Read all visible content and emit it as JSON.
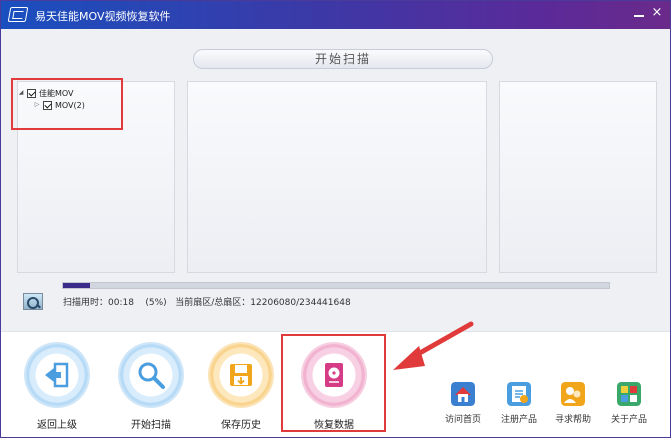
{
  "window": {
    "title": "易天佳能MOV视频恢复软件",
    "close_glyph": "×"
  },
  "scan_header": {
    "label": "开始扫描"
  },
  "tree": [
    {
      "label": "佳能MOV",
      "checked": true,
      "expanded": true
    },
    {
      "label": "MOV(2)",
      "checked": true,
      "expanded": false
    }
  ],
  "tree_glyphs": {
    "expanded": "◢",
    "collapsed": "▷"
  },
  "progress": {
    "percent_fraction": 0.05
  },
  "status": {
    "text": "扫描用时：00:18    (5%)   当前扇区/总扇区：12206080/234441648"
  },
  "footer": {
    "main_buttons": [
      {
        "label": "返回上级",
        "icon": "back-door-icon",
        "color": "#4a9ee0"
      },
      {
        "label": "开始扫描",
        "icon": "magnifier-icon",
        "color": "#4a9ee0"
      },
      {
        "label": "保存历史",
        "icon": "save-disk-icon",
        "color": "#f0a51a"
      },
      {
        "label": "恢复数据",
        "icon": "hard-drive-icon",
        "color": "#d63b86"
      }
    ],
    "small_buttons": [
      {
        "label": "访问首页",
        "icon": "home-icon"
      },
      {
        "label": "注册产品",
        "icon": "register-icon"
      },
      {
        "label": "寻求帮助",
        "icon": "help-icon"
      },
      {
        "label": "关于产品",
        "icon": "about-icon"
      }
    ]
  },
  "colors": {
    "accent_red": "#e03a3a",
    "progress_fill": "#3a2a8a"
  }
}
